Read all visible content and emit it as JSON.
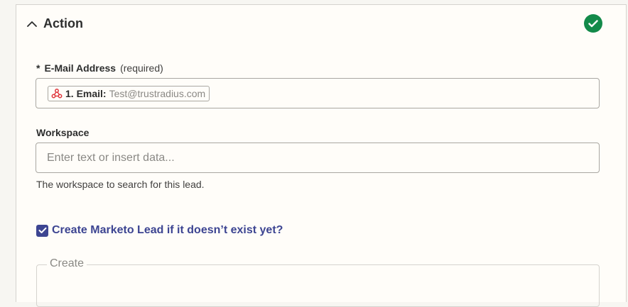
{
  "section": {
    "title": "Action",
    "status": "complete"
  },
  "email_field": {
    "required_marker": "*",
    "label": "E-Mail Address",
    "required_note": "(required)",
    "token": {
      "key": "1. Email:",
      "value": "Test@trustradius.com",
      "icon": "webhook-icon"
    }
  },
  "workspace_field": {
    "label": "Workspace",
    "placeholder": "Enter text or insert data...",
    "help": "The workspace to search for this lead."
  },
  "create_lead": {
    "checked": true,
    "label": "Create Marketo Lead if it doesn’t exist yet?"
  },
  "create_group": {
    "legend": "Create"
  },
  "colors": {
    "accent": "#3d4592",
    "success": "#138a4a",
    "token_icon": "#e0383e"
  }
}
